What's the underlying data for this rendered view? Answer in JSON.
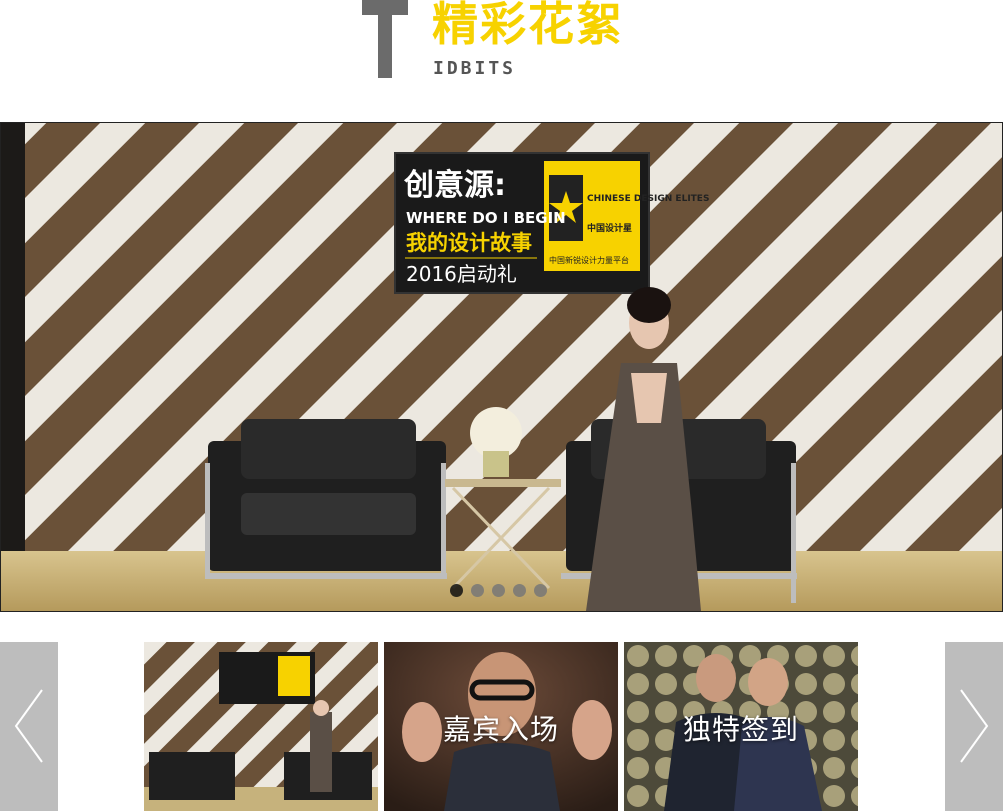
{
  "header": {
    "title_cn": "精彩花絮",
    "title_en": "IDBITS"
  },
  "hero": {
    "sign": {
      "title": "创意源:",
      "subtitle": "WHERE DO I BEGIN",
      "tagline": "我的设计故事",
      "event": "2016启动礼",
      "brand_en": "CHINESE DESIGN ELITES",
      "brand_cn": "中国设计星",
      "platform": "中国新锐设计力量平台"
    },
    "carousel": {
      "total": 5,
      "active": 1
    },
    "colors": {
      "accent": "#f7d200"
    }
  },
  "thumbnails": [
    {
      "label": ""
    },
    {
      "label": "嘉宾入场"
    },
    {
      "label": "独特签到"
    }
  ],
  "nav": {
    "prev_icon": "chevron-left-icon",
    "next_icon": "chevron-right-icon"
  }
}
